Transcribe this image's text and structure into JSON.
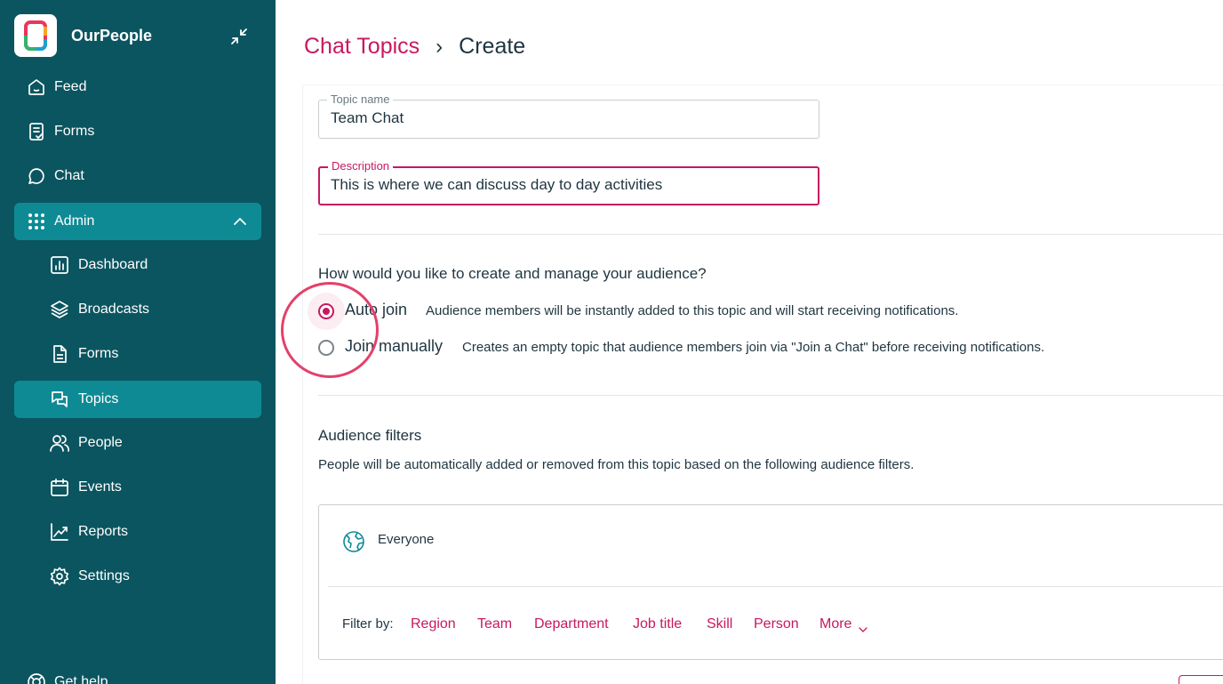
{
  "app": {
    "name": "OurPeople"
  },
  "sidebar": {
    "items": [
      {
        "label": "Feed",
        "icon": "home-icon"
      },
      {
        "label": "Forms",
        "icon": "form-check-icon"
      },
      {
        "label": "Chat",
        "icon": "chat-bubble-icon"
      },
      {
        "label": "Admin",
        "icon": "grid-dots-icon",
        "expanded": true
      },
      {
        "label": "Dashboard",
        "icon": "bar-chart-icon"
      },
      {
        "label": "Broadcasts",
        "icon": "layers-icon"
      },
      {
        "label": "Forms",
        "icon": "document-icon"
      },
      {
        "label": "Topics",
        "icon": "chat-bubbles-icon",
        "active": true
      },
      {
        "label": "People",
        "icon": "people-icon"
      },
      {
        "label": "Events",
        "icon": "calendar-icon"
      },
      {
        "label": "Reports",
        "icon": "trend-chart-icon"
      },
      {
        "label": "Settings",
        "icon": "gear-icon"
      }
    ],
    "help": {
      "label": "Get help",
      "icon": "lifebuoy-icon"
    }
  },
  "breadcrumb": {
    "parent": "Chat Topics",
    "separator": "›",
    "current": "Create"
  },
  "form": {
    "topic_name": {
      "label": "Topic name",
      "value": "Team Chat"
    },
    "description": {
      "label": "Description",
      "value": "This is where we can discuss day to day activities"
    }
  },
  "audience": {
    "question": "How would you like to create and manage your audience?",
    "options": [
      {
        "label": "Auto join",
        "description": "Audience members will be instantly added to this topic and will start receiving notifications.",
        "selected": true
      },
      {
        "label": "Join manually",
        "description": "Creates an empty topic that audience members join via \"Join a Chat\" before receiving notifications.",
        "selected": false
      }
    ]
  },
  "filters": {
    "title": "Audience filters",
    "description": "People will be automatically added or removed from this topic based on the following audience filters.",
    "everyone_label": "Everyone",
    "filter_by_label": "Filter by:",
    "links": [
      "Region",
      "Team",
      "Department",
      "Job title",
      "Skill",
      "Person",
      "More"
    ]
  },
  "colors": {
    "sidebar": "#0b5560",
    "active": "#0e8a95",
    "accent": "#c8185f"
  }
}
